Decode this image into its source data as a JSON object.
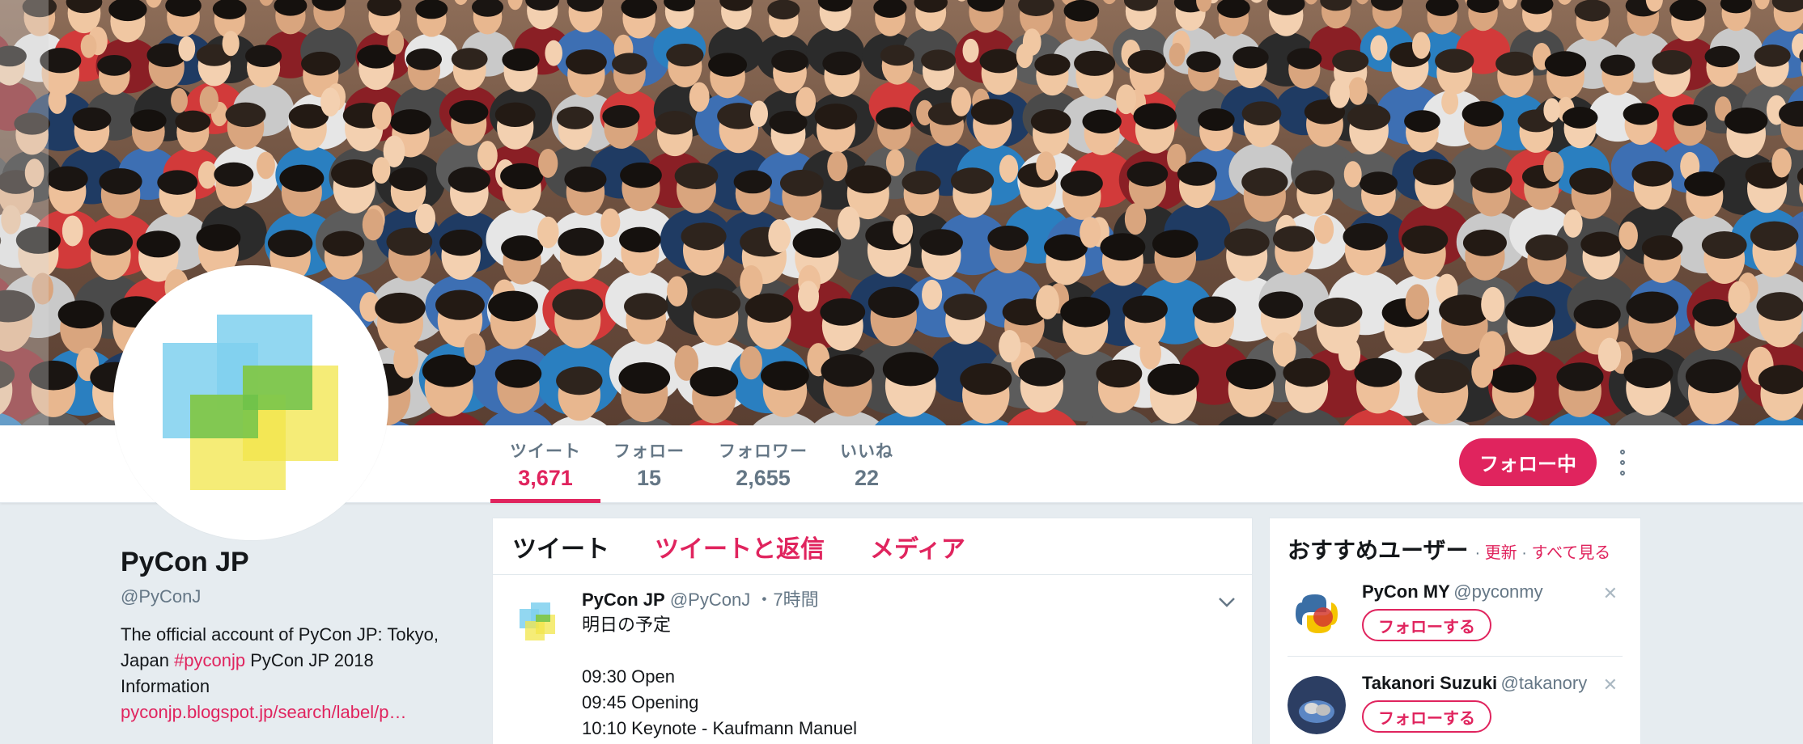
{
  "banner": {
    "description_icon": "crowd-photo"
  },
  "stats": [
    {
      "label": "ツイート",
      "value": "3,671"
    },
    {
      "label": "フォロー",
      "value": "15"
    },
    {
      "label": "フォロワー",
      "value": "2,655"
    },
    {
      "label": "いいね",
      "value": "22"
    }
  ],
  "follow_button": "フォロー中",
  "profile": {
    "name": "PyCon JP",
    "handle": "@PyConJ",
    "bio_line1": "The official account of PyCon JP: Tokyo,",
    "bio_line2_pre": "Japan ",
    "bio_hashtag": "#pyconjp",
    "bio_line2_post": " PyCon JP 2018",
    "bio_line3": "Information",
    "link": "pyconjp.blogspot.jp/search/label/p…"
  },
  "timeline": {
    "tabs": [
      "ツイート",
      "ツイートと返信",
      "メディア"
    ],
    "tweet": {
      "name": "PyCon JP",
      "handle": "@PyConJ",
      "time": "・7時間",
      "text": "明日の予定\n\n09:30 Open\n09:45 Opening\n10:10 Keynote - Kaufmann Manuel"
    }
  },
  "who_to_follow": {
    "title": "おすすめユーザー",
    "sep": "·",
    "refresh": "更新",
    "view_all": "すべて見る",
    "users": [
      {
        "name": "PyCon MY",
        "handle": "@pyconmy",
        "button": "フォローする"
      },
      {
        "name": "Takanori Suzuki",
        "handle": "@takanory",
        "button": "フォローする"
      }
    ]
  },
  "colors": {
    "accent": "#e0245e",
    "muted": "#657786",
    "background": "#e6ecf0"
  }
}
